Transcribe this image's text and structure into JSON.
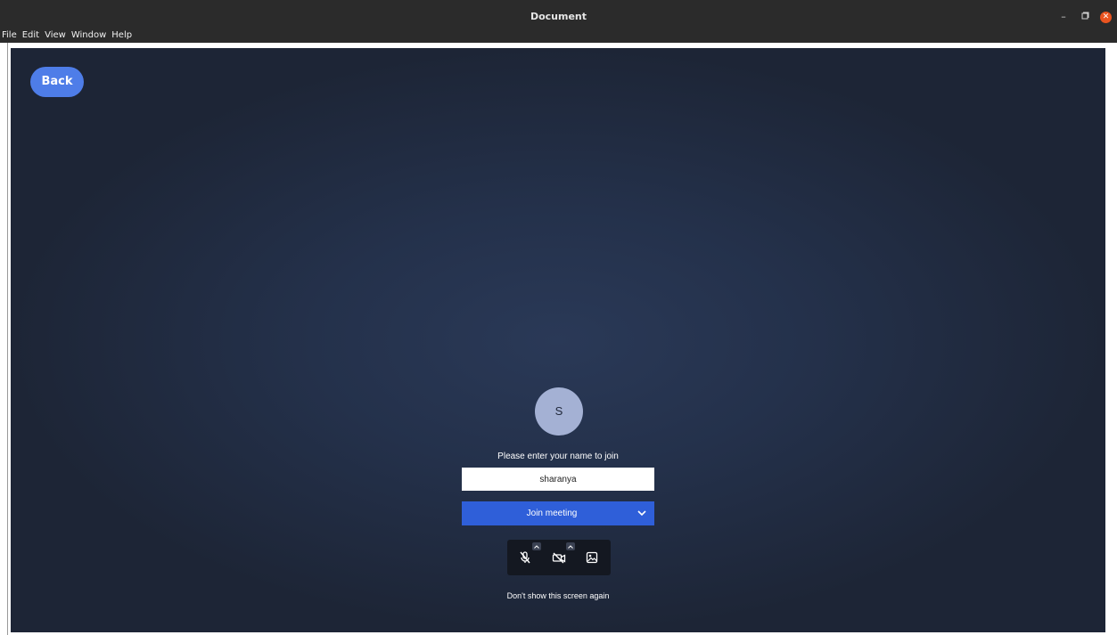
{
  "window": {
    "title": "Document",
    "minimize_glyph": "–",
    "restore_glyph": "▫",
    "close_glyph": "✕"
  },
  "menubar": {
    "items": [
      "File",
      "Edit",
      "View",
      "Window",
      "Help"
    ]
  },
  "prejoin": {
    "back_label": "Back",
    "avatar_initial": "S",
    "prompt": "Please enter your name to join",
    "name_value": "sharanya",
    "join_label": "Join meeting",
    "dont_show_label": "Don't show this screen again",
    "toolbar": {
      "mic_icon": "mic-off-icon",
      "camera_icon": "camera-off-icon",
      "background_icon": "virtual-background-icon"
    }
  },
  "colors": {
    "back_button": "#4e7de8",
    "join_button": "#2f5fd9",
    "avatar": "#a4b1d4",
    "close_button": "#e95420"
  }
}
